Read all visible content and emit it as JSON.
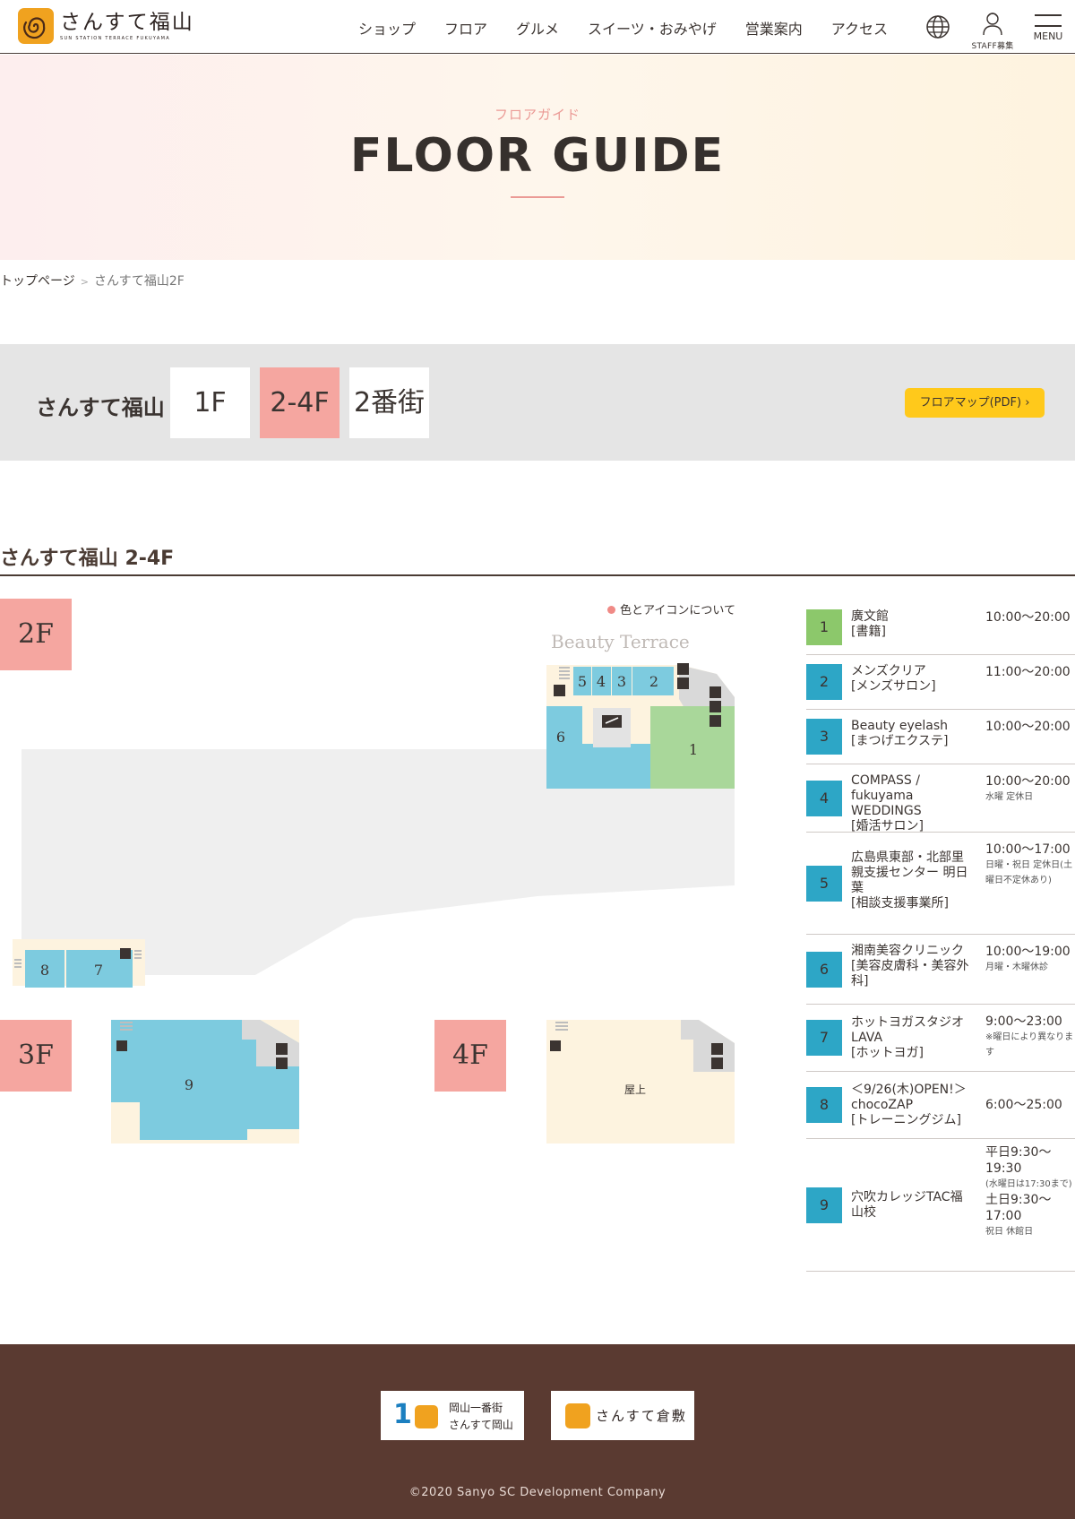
{
  "header": {
    "logo_title": "さんすて福山",
    "logo_sub": "SUN STATION TERRACE FUKUYAMA",
    "nav": [
      "ショップ",
      "フロア",
      "グルメ",
      "スイーツ・おみやげ",
      "営業案内",
      "アクセス"
    ],
    "staff_label": "STAFF募集",
    "menu_label": "MENU"
  },
  "hero": {
    "subtitle": "フロアガイド",
    "title": "FLOOR GUIDE"
  },
  "breadcrumb": {
    "home": "トップページ",
    "separator": ">",
    "current": "さんすて福山2F"
  },
  "floor_tabs": {
    "label": "さんすて福山",
    "tabs": [
      "1F",
      "2-4F",
      "2番街"
    ],
    "active": "2-4F",
    "pdf_button": "フロアマップ(PDF)"
  },
  "section": {
    "title": "さんすて福山 2-4F"
  },
  "map": {
    "legend_link": "色とアイコンについて",
    "beauty_terrace": "Beauty Terrace",
    "floors": [
      "2F",
      "3F",
      "4F"
    ],
    "units": [
      "1",
      "2",
      "3",
      "4",
      "5",
      "6",
      "7",
      "8",
      "9"
    ],
    "rooftop_label": "屋上"
  },
  "colors": {
    "book": "#8cc86b",
    "service": "#2da6c6",
    "store_bg": "#7dcbdf",
    "pink": "#f5a6a0",
    "yellow": "#ffc91b",
    "footer": "#5a3a31"
  },
  "shops": [
    {
      "num": "1",
      "name": "廣文館",
      "category": "[書籍]",
      "hours": "10:00〜20:00",
      "note": "",
      "color": "#8cc86b"
    },
    {
      "num": "2",
      "name": "メンズクリア",
      "category": "[メンズサロン]",
      "hours": "11:00〜20:00",
      "note": "",
      "color": "#2da6c6"
    },
    {
      "num": "3",
      "name": "Beauty eyelash",
      "category": "[まつげエクステ]",
      "hours": "10:00〜20:00",
      "note": "",
      "color": "#2da6c6"
    },
    {
      "num": "4",
      "name": "COMPASS / fukuyama WEDDINGS",
      "category": "[婚活サロン]",
      "hours": "10:00〜20:00",
      "note": "水曜 定休日",
      "color": "#2da6c6"
    },
    {
      "num": "5",
      "name": "広島県東部・北部里親支援センター 明日葉",
      "category": "[相談支援事業所]",
      "hours": "10:00〜17:00",
      "note": "日曜・祝日 定休日(土曜日不定休あり)",
      "color": "#2da6c6"
    },
    {
      "num": "6",
      "name": "湘南美容クリニック",
      "category": "[美容皮膚科・美容外科]",
      "hours": "10:00〜19:00",
      "note": "月曜・木曜休診",
      "color": "#2da6c6"
    },
    {
      "num": "7",
      "name": "ホットヨガスタジオLAVA",
      "category": "[ホットヨガ]",
      "hours": "9:00〜23:00",
      "note": "※曜日により異なります",
      "color": "#2da6c6"
    },
    {
      "num": "8",
      "name": "＜9/26(木)OPEN!＞chocoZAP",
      "category": "[トレーニングジム]",
      "hours": "6:00〜25:00",
      "note": "",
      "color": "#2da6c6"
    },
    {
      "num": "9",
      "name": "穴吹カレッジTAC福山校",
      "category": "",
      "hours": "平日9:30〜19:30",
      "note": "(水曜日は17:30まで)",
      "hours2": "土日9:30〜17:00",
      "note2": "祝日 休館日",
      "color": "#2da6c6"
    }
  ],
  "footer": {
    "logo1_title": "岡山一番街",
    "logo1_sub": "さんすて岡山",
    "logo2_title": "さんすて倉敷",
    "copyright": "©2020 Sanyo SC Development Company"
  }
}
